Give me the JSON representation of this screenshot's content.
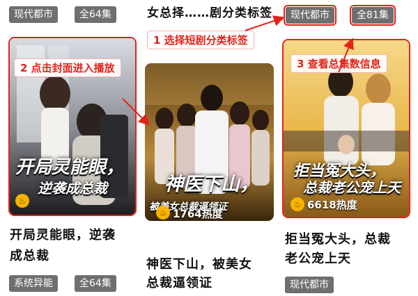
{
  "header": {
    "clipped_title": "女总择……剧分类标签"
  },
  "annotations": {
    "step1": "1 选择短剧分类标签",
    "step2": "2 点击封面进入播放",
    "step3": "3 查看总集数信息"
  },
  "colors": {
    "accent_red": "#e2231a",
    "tag_bg": "#6f6f6f"
  },
  "columns": [
    {
      "top_tags": [
        "现代都市",
        "全64集"
      ],
      "cover_title": "开局灵能眼，",
      "cover_subtitle": "逆袭成总裁",
      "title": "开局灵能眼，逆袭成总裁",
      "title_line1": "开局灵能眼，逆袭",
      "title_line2": "成总裁",
      "bottom_tags": [
        "系统异能",
        "全64集"
      ]
    },
    {
      "cover_title": "神医下山，",
      "cover_subtitle": "被美女总裁逼领证",
      "heat": "1764热度",
      "title_line1": "神医下山，被美女",
      "title_line2": "总裁逼领证"
    },
    {
      "top_tags": [
        "现代都市",
        "全81集"
      ],
      "cover_title": "拒当冤大头，",
      "cover_subtitle": "总裁老公宠上天",
      "heat": "6618热度",
      "title_line1": "拒当冤大头，总裁",
      "title_line2": "老公宠上天",
      "bottom_tags": [
        "现代都市"
      ]
    }
  ]
}
